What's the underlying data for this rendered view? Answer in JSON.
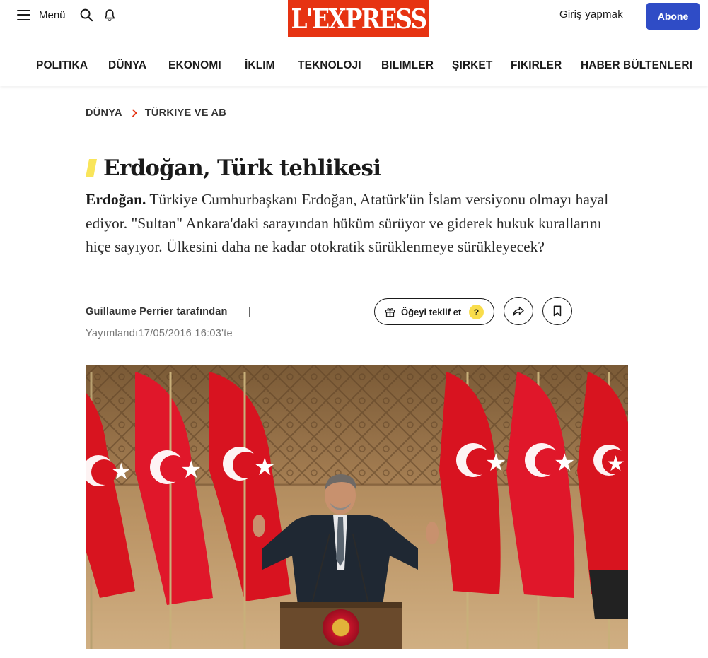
{
  "header": {
    "menu_label": "Menü",
    "logo_text": "L'EXPRESS",
    "login_label": "Giriş yapmak",
    "subscribe_label": "Abone",
    "brand_color": "#e63312",
    "accent_color": "#2f4cc6"
  },
  "nav": {
    "items": [
      "POLITIKA",
      "DÜNYA",
      "EKONOMI",
      "İKLIM",
      "TEKNOLOJI",
      "BILIMLER",
      "ŞIRKET",
      "FIKIRLER",
      "HABER BÜLTENLERI"
    ]
  },
  "breadcrumb": {
    "section": "DÜNYA",
    "subsection": "TÜRKIYE VE AB"
  },
  "article": {
    "title": "Erdoğan, Türk tehlikesi",
    "lead_strong": "Erdoğan.",
    "lead_text": " Türkiye Cumhurbaşkanı Erdoğan, Atatürk'ün İslam versiyonu olmayı hayal ediyor. \"Sultan\" Ankara'daki sarayından hüküm sürüyor ve giderek hukuk kurallarını hiçe sayıyor. Ülkesini daha ne kadar otokratik sürüklenmeye sürükleyecek?",
    "author": "Guillaume Perrier tarafından",
    "published": "Yayımlandı17/05/2016 16:03'te",
    "title_mark_color": "#f9e55a"
  },
  "actions": {
    "gift_label": "Öğeyi teklif et",
    "help_label": "?",
    "icons": [
      "gift-icon",
      "share-icon",
      "bookmark-icon"
    ]
  }
}
